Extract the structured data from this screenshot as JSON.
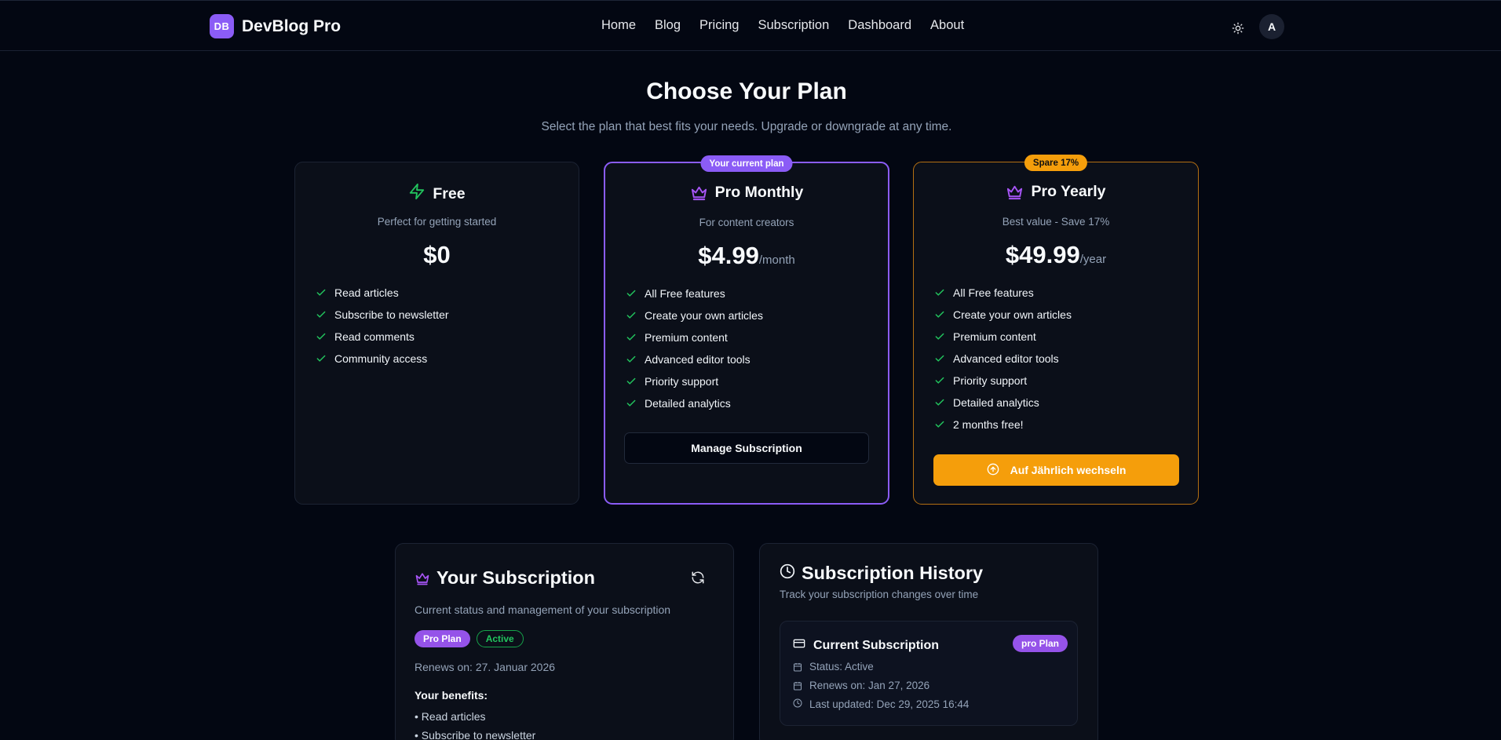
{
  "header": {
    "logo": "DB",
    "brand": "DevBlog Pro",
    "nav": [
      "Home",
      "Blog",
      "Pricing",
      "Subscription",
      "Dashboard",
      "About"
    ],
    "theme_icon": "sun-icon",
    "avatar": "A"
  },
  "hero": {
    "title": "Choose Your Plan",
    "subtitle": "Select the plan that best fits your needs. Upgrade or downgrade at any time."
  },
  "plans": [
    {
      "name": "Free",
      "icon": "lightning-icon",
      "description": "Perfect for getting started",
      "price": "$0",
      "period": "",
      "features": [
        "Read articles",
        "Subscribe to newsletter",
        "Read comments",
        "Community access"
      ]
    },
    {
      "name": "Pro Monthly",
      "icon": "crown-icon",
      "badge": "Your current plan",
      "description": "For content creators",
      "price": "$4.99",
      "period": "/month",
      "features": [
        "All Free features",
        "Create your own articles",
        "Premium content",
        "Advanced editor tools",
        "Priority support",
        "Detailed analytics"
      ],
      "button": "Manage Subscription"
    },
    {
      "name": "Pro Yearly",
      "icon": "crown-icon",
      "badge": "Spare 17%",
      "description": "Best value - Save 17%",
      "price": "$49.99",
      "period": "/year",
      "features": [
        "All Free features",
        "Create your own articles",
        "Premium content",
        "Advanced editor tools",
        "Priority support",
        "Detailed analytics",
        "2 months free!"
      ],
      "button": "Auf Jährlich wechseln"
    }
  ],
  "your_subscription": {
    "title": "Your Subscription",
    "description": "Current status and management of your subscription",
    "plan_chip": "Pro Plan",
    "status_chip": "Active",
    "renews": "Renews on: 27. Januar 2026",
    "benefits_heading": "Your benefits:",
    "benefits": [
      "• Read articles",
      "• Subscribe to newsletter"
    ]
  },
  "subscription_history": {
    "title": "Subscription History",
    "description": "Track your subscription changes over time",
    "current_title": "Current Subscription",
    "current_chip": "pro Plan",
    "status": "Status: Active",
    "renews": "Renews on: Jan 27, 2026",
    "updated": "Last updated: Dec 29, 2025 16:44"
  },
  "colors": {
    "background": "#030712",
    "card": "#0b0f19",
    "accent_purple": "#8b5cf6",
    "accent_amber": "#f59e0b",
    "check_green": "#22c55e"
  }
}
